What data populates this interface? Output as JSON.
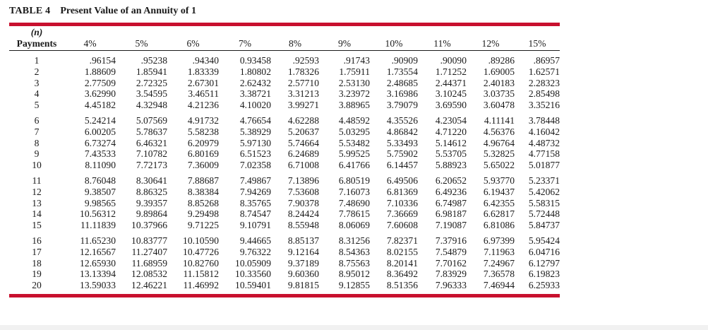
{
  "table_title": {
    "label": "TABLE 4",
    "name": "Present Value of an Annuity of 1"
  },
  "header": {
    "n_label": "(n)",
    "payments_label": "Payments",
    "rates": [
      "4%",
      "5%",
      "6%",
      "7%",
      "8%",
      "9%",
      "10%",
      "11%",
      "12%",
      "15%"
    ]
  },
  "rows": [
    [
      "1",
      ".96154",
      ".95238",
      ".94340",
      "0.93458",
      ".92593",
      ".91743",
      ".90909",
      ".90090",
      ".89286",
      ".86957"
    ],
    [
      "2",
      "1.88609",
      "1.85941",
      "1.83339",
      "1.80802",
      "1.78326",
      "1.75911",
      "1.73554",
      "1.71252",
      "1.69005",
      "1.62571"
    ],
    [
      "3",
      "2.77509",
      "2.72325",
      "2.67301",
      "2.62432",
      "2.57710",
      "2.53130",
      "2.48685",
      "2.44371",
      "2.40183",
      "2.28323"
    ],
    [
      "4",
      "3.62990",
      "3.54595",
      "3.46511",
      "3.38721",
      "3.31213",
      "3.23972",
      "3.16986",
      "3.10245",
      "3.03735",
      "2.85498"
    ],
    [
      "5",
      "4.45182",
      "4.32948",
      "4.21236",
      "4.10020",
      "3.99271",
      "3.88965",
      "3.79079",
      "3.69590",
      "3.60478",
      "3.35216"
    ],
    [
      "6",
      "5.24214",
      "5.07569",
      "4.91732",
      "4.76654",
      "4.62288",
      "4.48592",
      "4.35526",
      "4.23054",
      "4.11141",
      "3.78448"
    ],
    [
      "7",
      "6.00205",
      "5.78637",
      "5.58238",
      "5.38929",
      "5.20637",
      "5.03295",
      "4.86842",
      "4.71220",
      "4.56376",
      "4.16042"
    ],
    [
      "8",
      "6.73274",
      "6.46321",
      "6.20979",
      "5.97130",
      "5.74664",
      "5.53482",
      "5.33493",
      "5.14612",
      "4.96764",
      "4.48732"
    ],
    [
      "9",
      "7.43533",
      "7.10782",
      "6.80169",
      "6.51523",
      "6.24689",
      "5.99525",
      "5.75902",
      "5.53705",
      "5.32825",
      "4.77158"
    ],
    [
      "10",
      "8.11090",
      "7.72173",
      "7.36009",
      "7.02358",
      "6.71008",
      "6.41766",
      "6.14457",
      "5.88923",
      "5.65022",
      "5.01877"
    ],
    [
      "11",
      "8.76048",
      "8.30641",
      "7.88687",
      "7.49867",
      "7.13896",
      "6.80519",
      "6.49506",
      "6.20652",
      "5.93770",
      "5.23371"
    ],
    [
      "12",
      "9.38507",
      "8.86325",
      "8.38384",
      "7.94269",
      "7.53608",
      "7.16073",
      "6.81369",
      "6.49236",
      "6.19437",
      "5.42062"
    ],
    [
      "13",
      "9.98565",
      "9.39357",
      "8.85268",
      "8.35765",
      "7.90378",
      "7.48690",
      "7.10336",
      "6.74987",
      "6.42355",
      "5.58315"
    ],
    [
      "14",
      "10.56312",
      "9.89864",
      "9.29498",
      "8.74547",
      "8.24424",
      "7.78615",
      "7.36669",
      "6.98187",
      "6.62817",
      "5.72448"
    ],
    [
      "15",
      "11.11839",
      "10.37966",
      "9.71225",
      "9.10791",
      "8.55948",
      "8.06069",
      "7.60608",
      "7.19087",
      "6.81086",
      "5.84737"
    ],
    [
      "16",
      "11.65230",
      "10.83777",
      "10.10590",
      "9.44665",
      "8.85137",
      "8.31256",
      "7.82371",
      "7.37916",
      "6.97399",
      "5.95424"
    ],
    [
      "17",
      "12.16567",
      "11.27407",
      "10.47726",
      "9.76322",
      "9.12164",
      "8.54363",
      "8.02155",
      "7.54879",
      "7.11963",
      "6.04716"
    ],
    [
      "18",
      "12.65930",
      "11.68959",
      "10.82760",
      "10.05909",
      "9.37189",
      "8.75563",
      "8.20141",
      "7.70162",
      "7.24967",
      "6.12797"
    ],
    [
      "19",
      "13.13394",
      "12.08532",
      "11.15812",
      "10.33560",
      "9.60360",
      "8.95012",
      "8.36492",
      "7.83929",
      "7.36578",
      "6.19823"
    ],
    [
      "20",
      "13.59033",
      "12.46221",
      "11.46992",
      "10.59401",
      "9.81815",
      "9.12855",
      "8.51356",
      "7.96333",
      "7.46944",
      "6.25933"
    ]
  ],
  "colors": {
    "rule": "#c8102e"
  }
}
